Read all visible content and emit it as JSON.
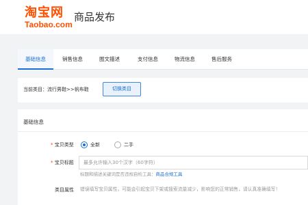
{
  "header": {
    "logo_main": "淘宝网",
    "logo_sub": "Taobao.com",
    "title": "商品发布"
  },
  "tabs": [
    {
      "label": "基础信息",
      "active": true
    },
    {
      "label": "销售信息",
      "active": false
    },
    {
      "label": "图文描述",
      "active": false
    },
    {
      "label": "支付信息",
      "active": false
    },
    {
      "label": "物流信息",
      "active": false
    },
    {
      "label": "售后服务",
      "active": false
    }
  ],
  "category": {
    "current_label": "当前类目：流行男鞋>>帆布鞋",
    "switch_button": "切换类目"
  },
  "basic_info": {
    "section_title": "基础信息",
    "required_mark": "*",
    "item_type": {
      "label": "宝贝类型",
      "options": [
        {
          "label": "全新",
          "checked": true
        },
        {
          "label": "二手",
          "checked": false
        }
      ]
    },
    "item_title": {
      "label": "宝贝标题",
      "placeholder": "最多允许输入30个汉字（60字符）",
      "hint_text": "标题和描述关键词是否违规自检工具：",
      "hint_link": "商品合规工具"
    },
    "category_attrs": {
      "label": "类目属性",
      "hint": "错误填写宝贝属性，可能会引起宝贝下架或搜索流量减少，影响您的正常销售，请认真准确填写！"
    }
  },
  "colors": {
    "brand_orange": "#ff5000",
    "accent_blue": "#1a6fd4",
    "required_red": "#ff3300"
  }
}
